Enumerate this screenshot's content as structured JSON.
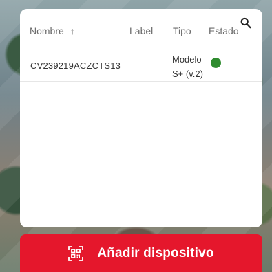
{
  "table": {
    "headers": {
      "name": "Nombre",
      "label": "Label",
      "tipo": "Tipo",
      "estado": "Estado"
    },
    "sort_icon": "arrow-up-icon",
    "search_icon": "search-icon",
    "rows": [
      {
        "name": "CV239219ACZCTS13",
        "label": "",
        "tipo_line1": "Modelo",
        "tipo_line2": "S+ (v.2)",
        "status_color": "#2e8b2e"
      }
    ]
  },
  "add_button": {
    "label": "Añadir dispositivo",
    "icon": "qr-scan-icon",
    "color": "#e5172c"
  }
}
